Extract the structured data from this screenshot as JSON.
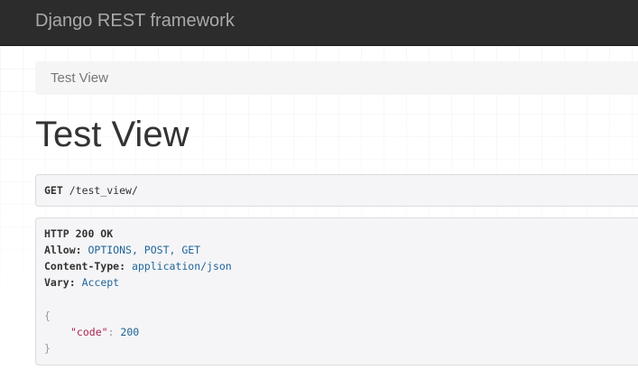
{
  "navbar": {
    "brand": "Django REST framework"
  },
  "breadcrumb": {
    "items": [
      "Test View"
    ]
  },
  "page": {
    "title": "Test View"
  },
  "request": {
    "method": "GET",
    "path": "/test_view/"
  },
  "response": {
    "status_line": "HTTP 200 OK",
    "headers": [
      {
        "name": "Allow:",
        "value": "OPTIONS, POST, GET"
      },
      {
        "name": "Content-Type:",
        "value": "application/json"
      },
      {
        "name": "Vary:",
        "value": "Accept"
      }
    ],
    "body": {
      "open_brace": "{",
      "key": "\"code\"",
      "colon": ":",
      "value": "200",
      "close_brace": "}"
    }
  },
  "colors": {
    "navbar_bg": "#2c2c2c",
    "brand_text": "#a9a9a9",
    "header_value": "#1f6499",
    "json_key": "#b0214f"
  }
}
